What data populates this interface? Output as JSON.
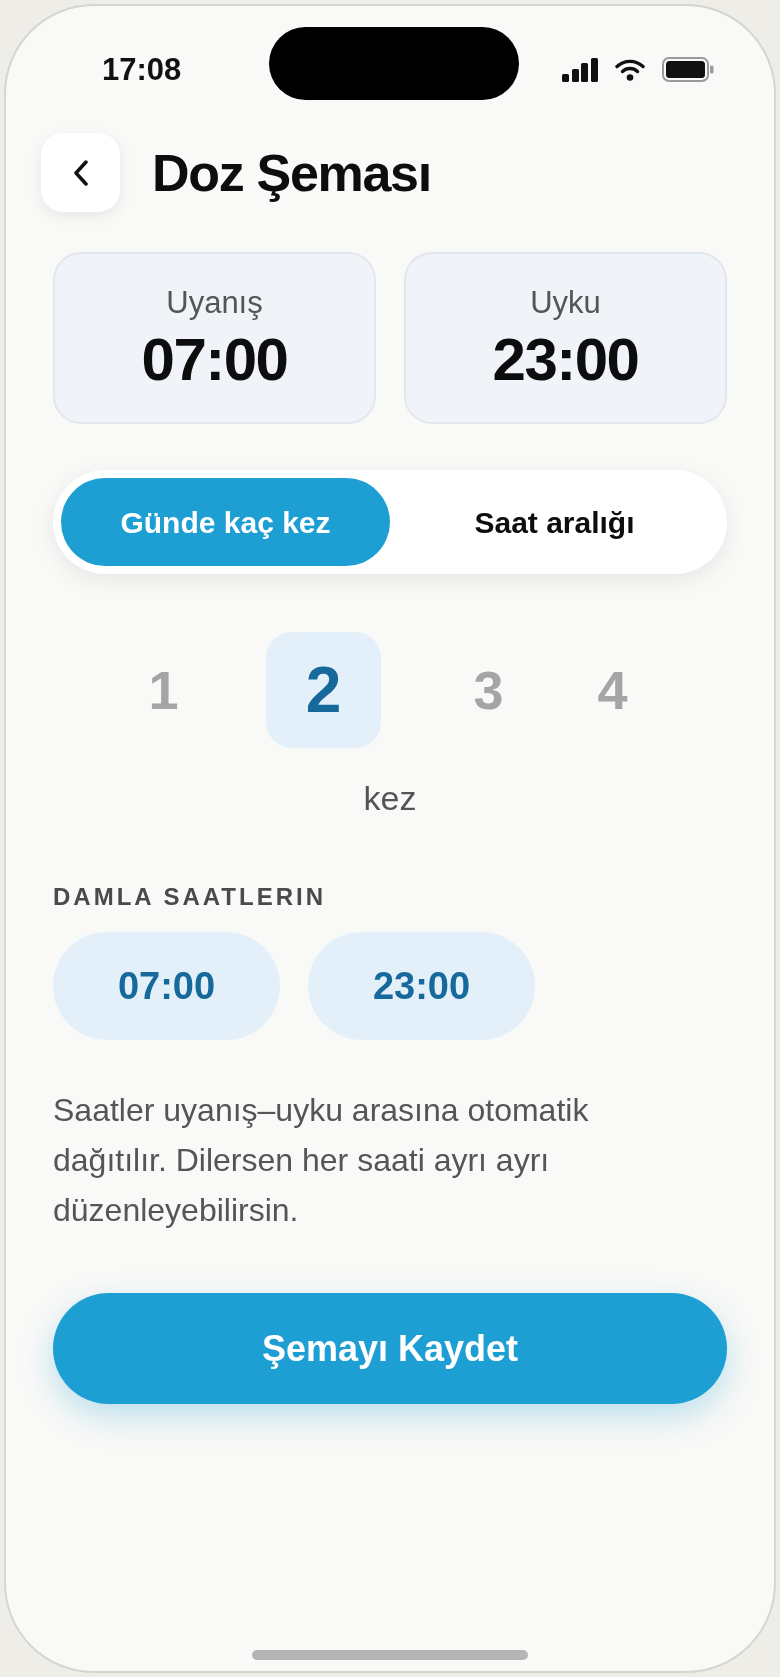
{
  "status_bar": {
    "time": "17:08"
  },
  "header": {
    "title": "Doz Şeması"
  },
  "times": [
    {
      "label": "Uyanış",
      "value": "07:00"
    },
    {
      "label": "Uyku",
      "value": "23:00"
    }
  ],
  "mode_tabs": [
    {
      "label": "Günde kaç kez",
      "selected": true
    },
    {
      "label": "Saat aralığı",
      "selected": false
    }
  ],
  "count_picker": {
    "options": [
      {
        "label": "1",
        "selected": false
      },
      {
        "label": "2",
        "selected": true
      },
      {
        "label": "3",
        "selected": false
      },
      {
        "label": "4",
        "selected": false
      }
    ],
    "unit": "kez"
  },
  "drop_times": {
    "heading": "DAMLA SAATLERIN",
    "chips": [
      "07:00",
      "23:00"
    ]
  },
  "note": "Saatler uyanış–uyku arasına otomatik dağıtılır. Dilersen her saati ayrı ayrı düzenleyebilirsin.",
  "save_button": {
    "label": "Şemayı Kaydet"
  }
}
